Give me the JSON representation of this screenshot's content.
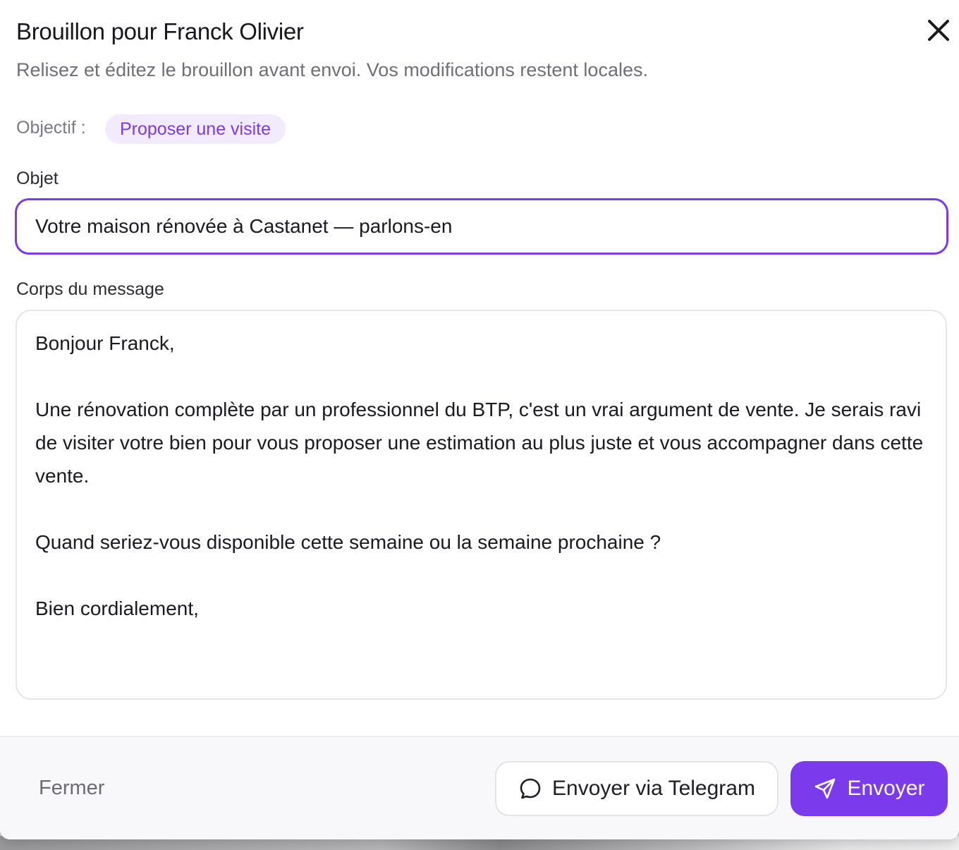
{
  "dialog": {
    "title": "Brouillon pour Franck Olivier",
    "subtitle": "Relisez et éditez le brouillon avant envoi. Vos modifications restent locales."
  },
  "objective": {
    "label": "Objectif :",
    "value": "Proposer une visite"
  },
  "subject": {
    "label": "Objet",
    "value": "Votre maison rénovée à Castanet — parlons-en"
  },
  "message": {
    "label": "Corps du message",
    "value": "Bonjour Franck,\n\nUne rénovation complète par un professionnel du BTP, c'est un vrai argument de vente. Je serais ravi de visiter votre bien pour vous proposer une estimation au plus juste et vous accompagner dans cette vente.\n\nQuand seriez-vous disponible cette semaine ou la semaine prochaine ?\n\nBien cordialement,"
  },
  "footer": {
    "close_label": "Fermer",
    "telegram_label": "Envoyer via Telegram",
    "send_label": "Envoyer"
  },
  "icons": {
    "close": "close-icon",
    "telegram": "chat-bubble-icon",
    "send": "send-icon"
  },
  "colors": {
    "accent": "#7c3aed",
    "chip_background": "#f1ebfd"
  }
}
